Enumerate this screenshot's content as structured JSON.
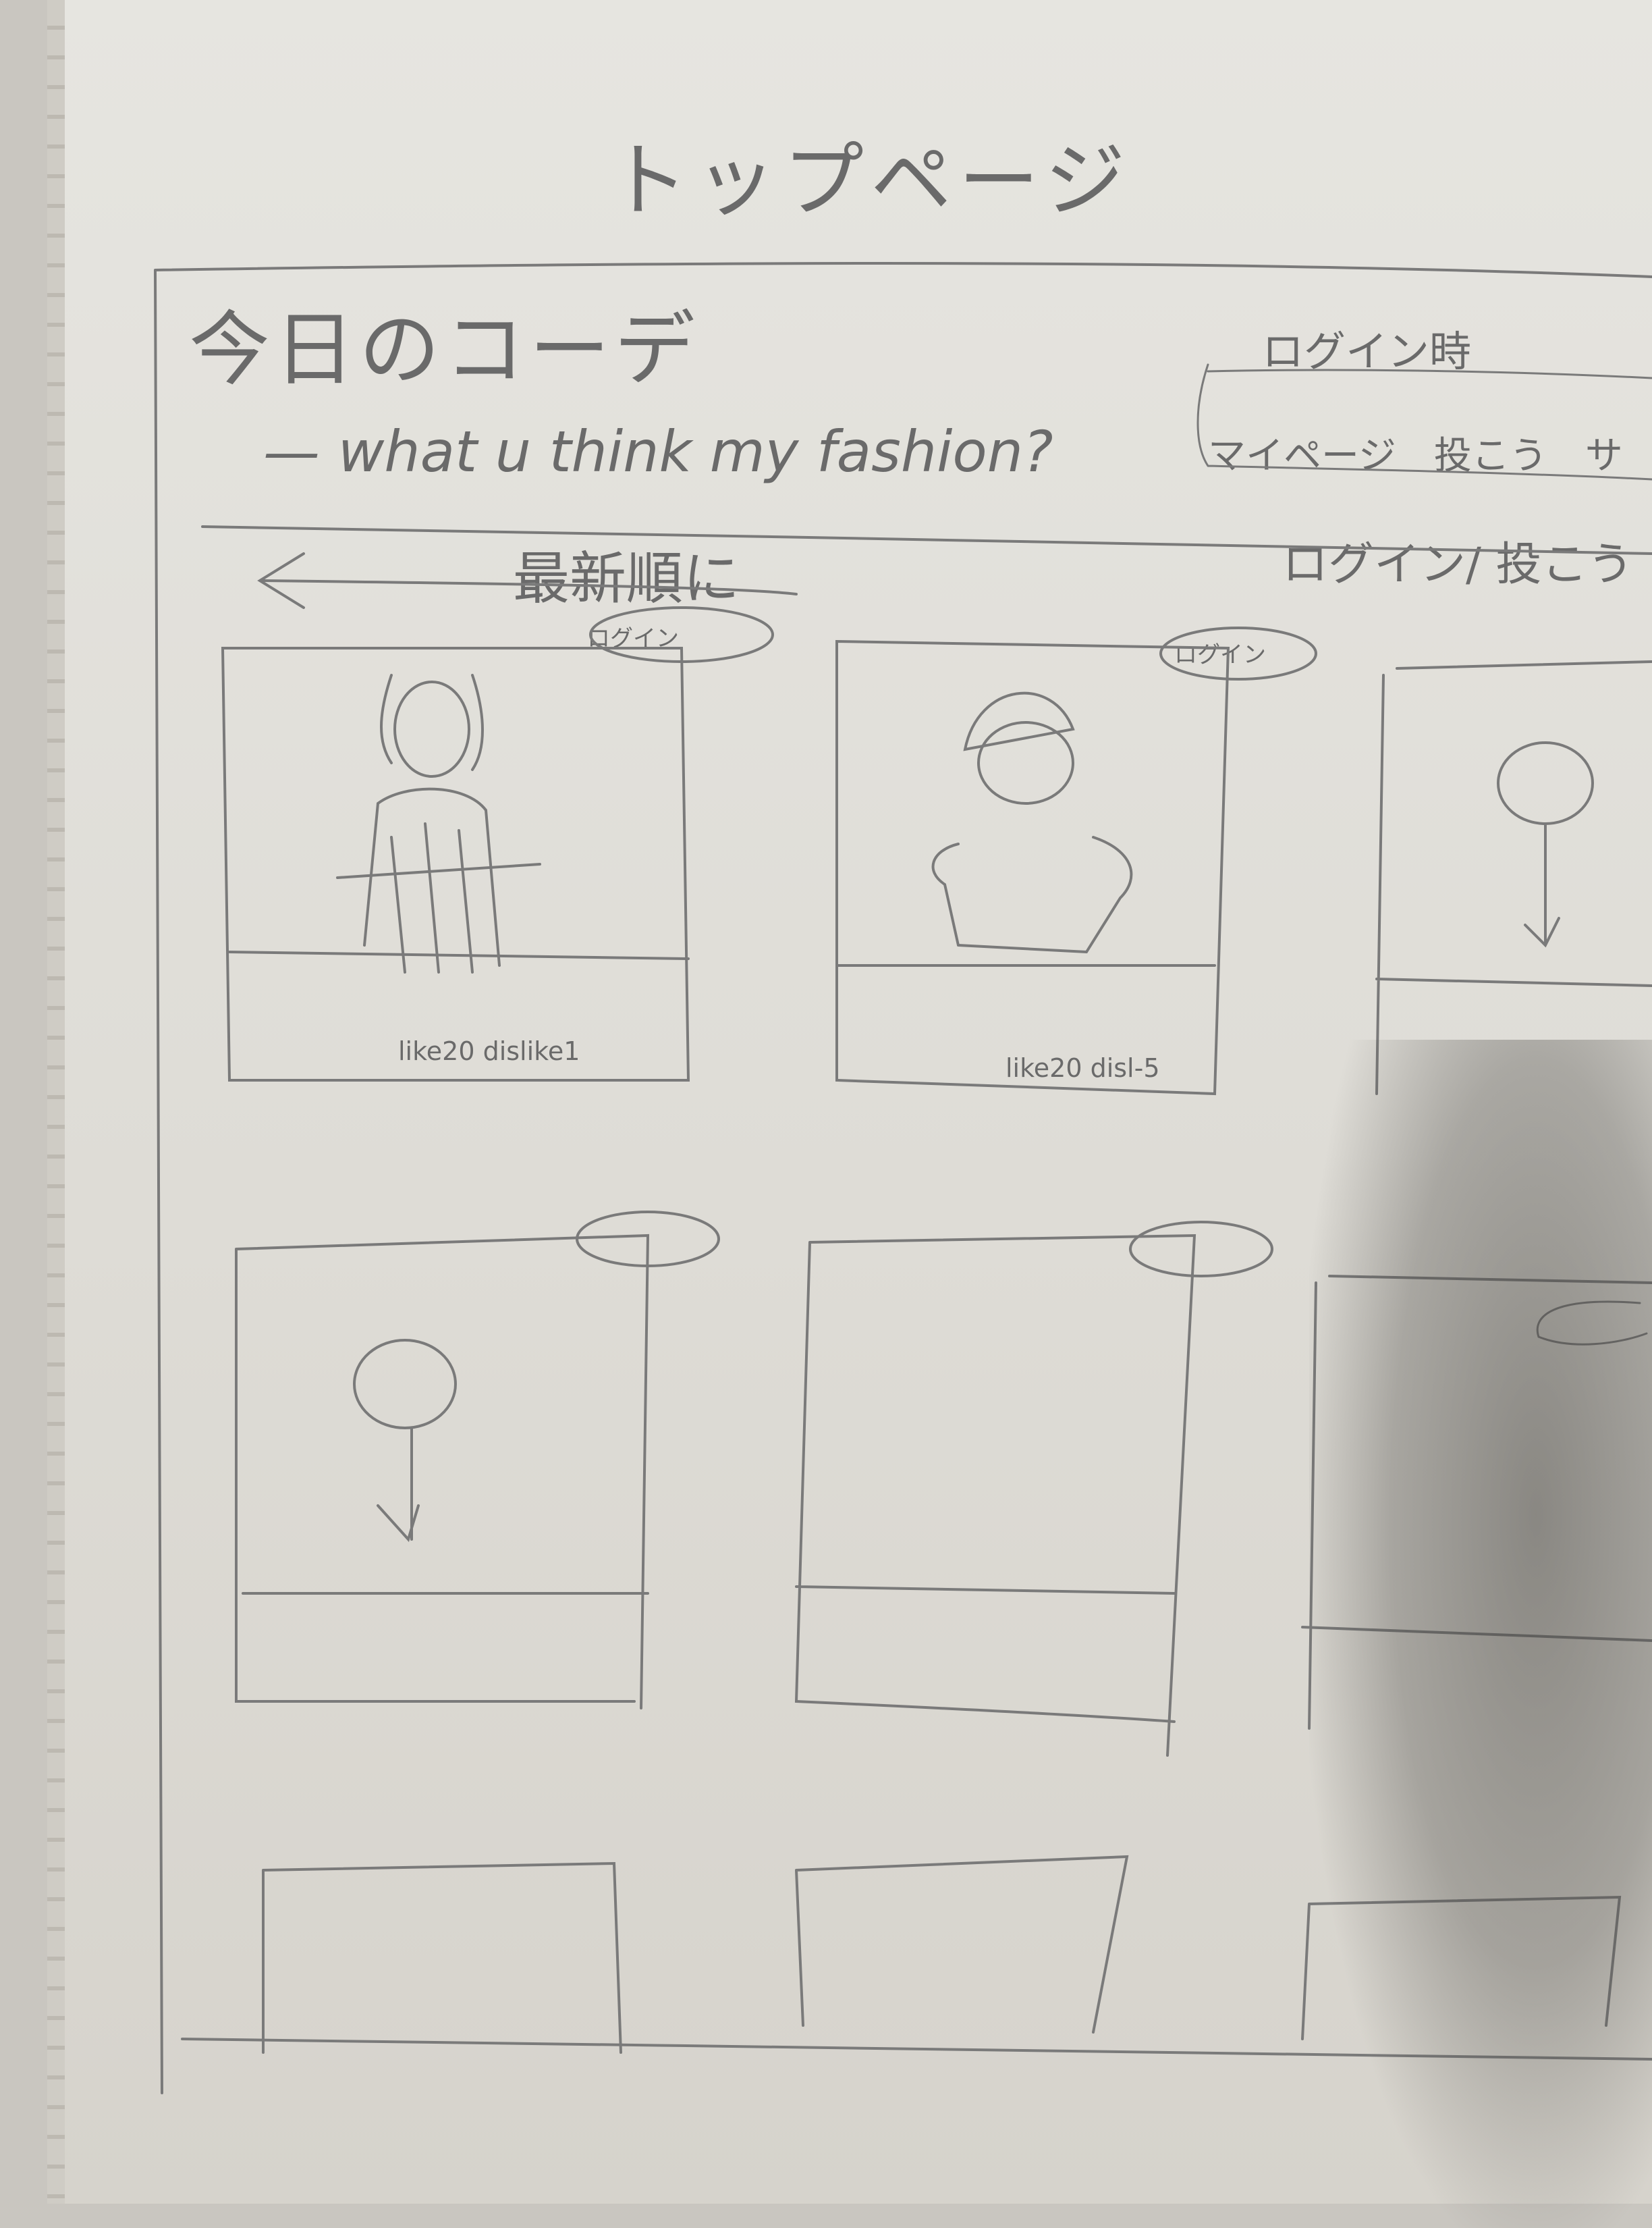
{
  "page_title": "トップページ",
  "header": {
    "site_title": "今日のコーデ",
    "tagline": "— what u think my fashion?"
  },
  "login_note": {
    "label": "ログイン時",
    "links": "マイページ　投こう　サ"
  },
  "nav": {
    "sort_label": "最新順に",
    "right_links": "ログイン/ 投こう"
  },
  "cards": [
    {
      "badge": "ログイン",
      "stats": "like20  dislike1"
    },
    {
      "badge": "ログイン",
      "stats": "like20  disl-5"
    }
  ]
}
